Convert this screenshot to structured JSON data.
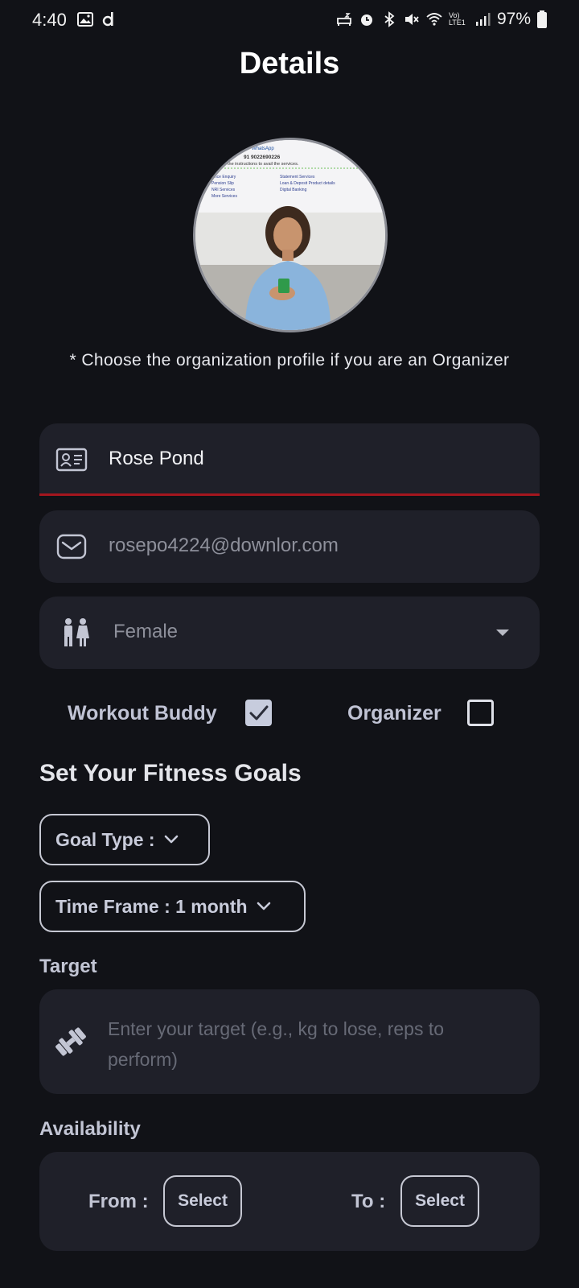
{
  "status_bar": {
    "time": "4:40",
    "battery": "97%",
    "network_label": "Vo) LTE1"
  },
  "page": {
    "title": "Details",
    "hint": "* Choose the organization profile if you are an Organizer"
  },
  "avatar": {
    "photo_text_lines": [
      "91 9022690226",
      "the instructions to avail the services.",
      "lance Enquiry",
      "Pension Slip",
      "NRI Services",
      "More Services",
      "Statement Services",
      "Loan & Deposit Product details",
      "Digital Banking"
    ],
    "photo_text_header": "WhatsApp"
  },
  "form": {
    "name": {
      "value": "Rose Pond",
      "icon": "id-card-icon"
    },
    "email": {
      "value": "rosepo4224@downlor.com",
      "icon": "mail-icon"
    },
    "gender": {
      "value": "Female",
      "icon": "people-icon"
    }
  },
  "roles": {
    "workout_buddy": {
      "label": "Workout Buddy",
      "checked": true
    },
    "organizer": {
      "label": "Organizer",
      "checked": false
    }
  },
  "fitness": {
    "title": "Set Your Fitness Goals",
    "goal_type_label": "Goal Type :",
    "time_frame_label": "Time Frame : 1 month"
  },
  "target": {
    "label": "Target",
    "placeholder": "Enter your target (e.g., kg to lose, reps to perform)"
  },
  "availability": {
    "label": "Availability",
    "from_label": "From :",
    "to_label": "To :",
    "from_button": "Select",
    "to_button": "Select"
  },
  "colors": {
    "background": "#111217",
    "field_bg": "#1f2029",
    "error_underline": "#a4161e",
    "checkbox_checked": "#c7ccdd"
  }
}
